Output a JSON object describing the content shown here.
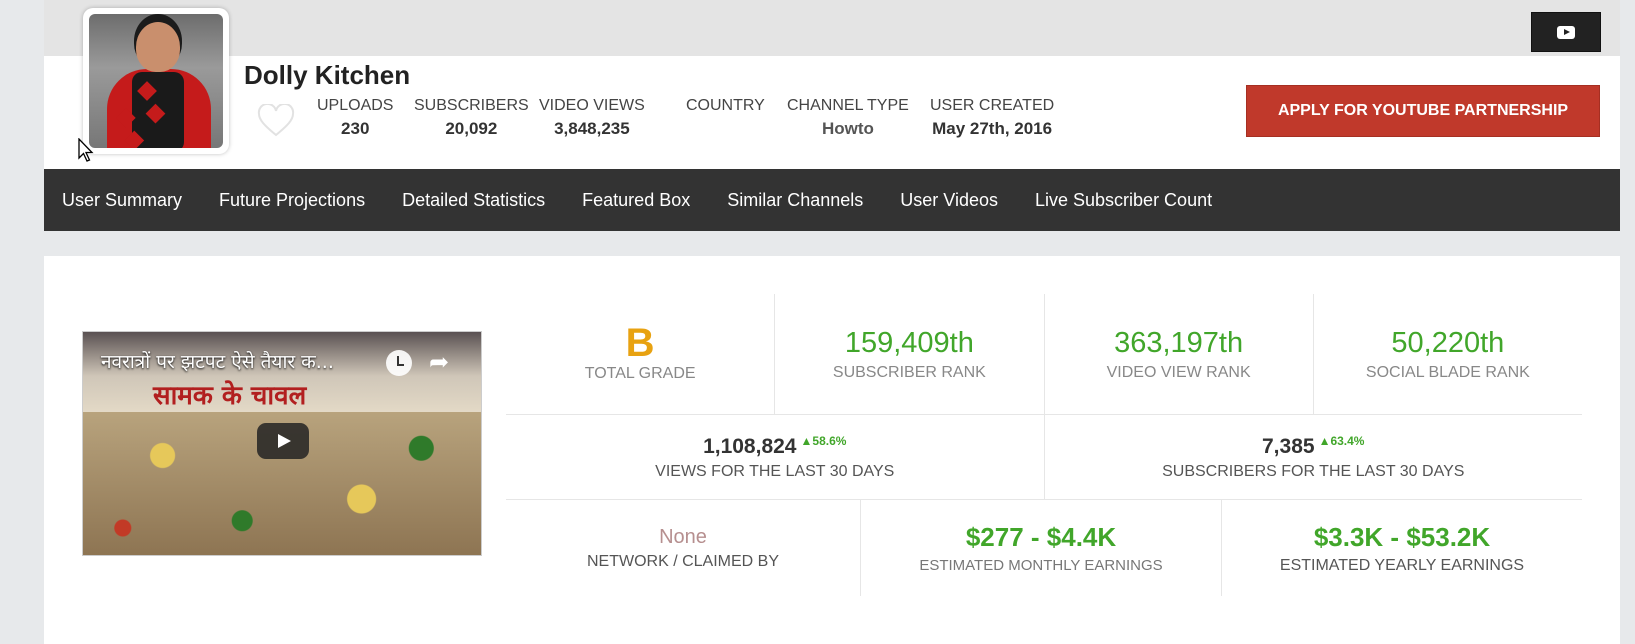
{
  "channel": {
    "name": "Dolly Kitchen"
  },
  "stats": [
    {
      "label": "UPLOADS",
      "value": "230"
    },
    {
      "label": "SUBSCRIBERS",
      "value": "20,092"
    },
    {
      "label": "VIDEO VIEWS",
      "value": "3,848,235"
    },
    {
      "label": "COUNTRY",
      "value": ""
    },
    {
      "label": "CHANNEL TYPE",
      "value": "Howto"
    },
    {
      "label": "USER CREATED",
      "value": "May 27th, 2016"
    }
  ],
  "apply_button": "APPLY FOR YOUTUBE PARTNERSHIP",
  "nav": [
    "User Summary",
    "Future Projections",
    "Detailed Statistics",
    "Featured Box",
    "Similar Channels",
    "User Videos",
    "Live Subscriber Count"
  ],
  "video": {
    "title": "नवरात्रों पर झटपट ऐसे तैयार क...",
    "thumbnail_text": "सामक के चावल"
  },
  "ranks": {
    "grade": {
      "value": "B",
      "label": "TOTAL GRADE"
    },
    "subscriber_rank": {
      "value": "159,409th",
      "label": "SUBSCRIBER RANK"
    },
    "video_view_rank": {
      "value": "363,197th",
      "label": "VIDEO VIEW RANK"
    },
    "social_blade_rank": {
      "value": "50,220th",
      "label": "SOCIAL BLADE RANK"
    }
  },
  "last30": {
    "views": {
      "value": "1,108,824",
      "change": "58.6%",
      "label": "VIEWS FOR THE LAST 30 DAYS"
    },
    "subscribers": {
      "value": "7,385",
      "change": "63.4%",
      "label": "SUBSCRIBERS FOR THE LAST 30 DAYS"
    }
  },
  "earnings": {
    "network": {
      "value": "None",
      "label": "NETWORK / CLAIMED BY"
    },
    "monthly": {
      "value": "$277 - $4.4K",
      "label": "ESTIMATED MONTHLY EARNINGS"
    },
    "yearly": {
      "value": "$3.3K - $53.2K",
      "label": "ESTIMATED YEARLY EARNINGS"
    }
  },
  "colors": {
    "accent_green": "#41a62a",
    "grade_orange": "#e8a211",
    "apply_red": "#c0392b",
    "nav_bg": "#333333"
  },
  "icons": [
    "youtube-icon",
    "heart-icon",
    "clock-icon",
    "share-icon",
    "play-icon"
  ]
}
